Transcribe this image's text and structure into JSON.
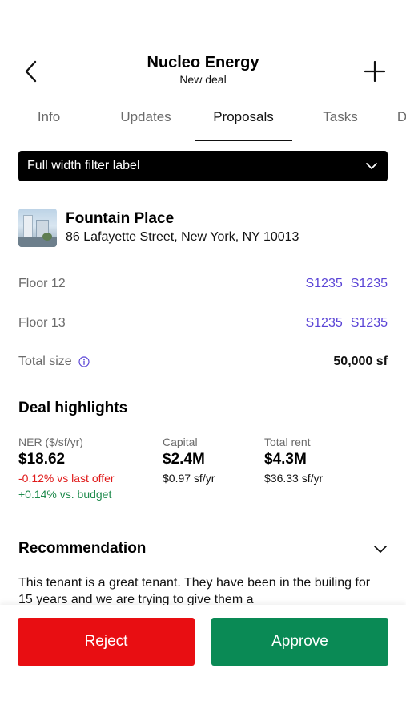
{
  "header": {
    "title": "Nucleo Energy",
    "subtitle": "New deal",
    "back_icon": "chevron-left-icon",
    "add_icon": "plus-icon"
  },
  "tabs": [
    {
      "label": "Info",
      "active": false
    },
    {
      "label": "Updates",
      "active": false
    },
    {
      "label": "Proposals",
      "active": true
    },
    {
      "label": "Tasks",
      "active": false
    },
    {
      "label": "D",
      "active": false
    }
  ],
  "filter": {
    "label": "Full width filter label",
    "icon": "chevron-down-icon"
  },
  "property": {
    "name": "Fountain Place",
    "address": "86 Lafayette Street, New York, NY 10013"
  },
  "floors": [
    {
      "label": "Floor 12",
      "links": [
        "S1235",
        "S1235"
      ]
    },
    {
      "label": "Floor 13",
      "links": [
        "S1235",
        "S1235"
      ]
    }
  ],
  "total_size": {
    "label": "Total size",
    "value": "50,000 sf",
    "icon": "info-icon"
  },
  "deal_highlights": {
    "title": "Deal highlights",
    "metrics": [
      {
        "label": "NER ($/sf/yr)",
        "value": "$18.62",
        "sub1": "-0.12% vs last offer",
        "sub2": "+0.14% vs. budget"
      },
      {
        "label": "Capital",
        "value": "$2.4M",
        "sub1": "$0.97 sf/yr"
      },
      {
        "label": "Total rent",
        "value": "$4.3M",
        "sub1": "$36.33 sf/yr"
      }
    ]
  },
  "recommendation": {
    "title": "Recommendation",
    "text": "This tenant is a great tenant. They have been in the builing for 15 years and we are trying to give them a"
  },
  "actions": {
    "reject_label": "Reject",
    "approve_label": "Approve"
  },
  "colors": {
    "link": "#5a44d6",
    "negative": "#e01b1b",
    "positive": "#1e8a4c",
    "reject": "#e80e12",
    "approve": "#0a8a55"
  }
}
